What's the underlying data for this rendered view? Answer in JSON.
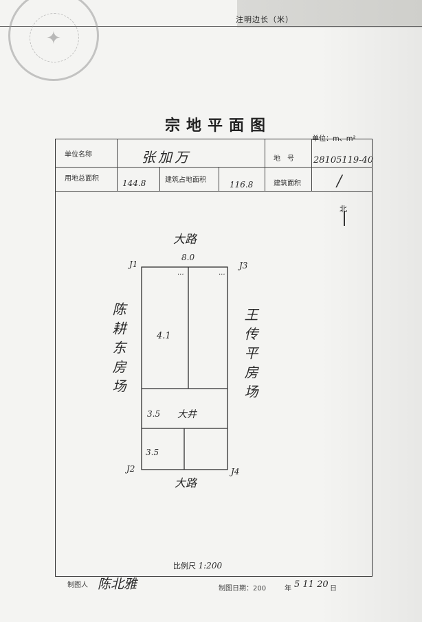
{
  "header": {
    "note": "注明边长（米）"
  },
  "seal": {
    "text": "印章",
    "color": "#9a9a9a"
  },
  "title": "宗地平面图",
  "unit": "单位：m、m²",
  "form": {
    "owner_label": "单位名称",
    "owner_value": "张加万",
    "parcel_label": "地　号",
    "parcel_value": "28105119-40",
    "land_area_label": "用地总面积",
    "land_area_value": "144.8",
    "building_area_label": "建筑占地面积",
    "building_area_value": "116.8",
    "floor_area_label": "建筑面积",
    "floor_area_value": "/"
  },
  "plan": {
    "north_label": "北",
    "north_side": "大路",
    "south_side": "大路",
    "top_dim": "8.0",
    "west_neighbor": "陈耕东房场",
    "east_neighbor": "王传平房场",
    "corner_labels": [
      "J1",
      "J2",
      "J3",
      "J4"
    ],
    "main_room": "4.1",
    "middle_room_dim": "3.5",
    "middle_room_text": "大井",
    "lower_room_dim": "3.5",
    "dots": "..."
  },
  "footer": {
    "scale_label": "比例尺",
    "scale_value": "1:200",
    "drafter_label": "制图人",
    "drafter_value": "陈北雅",
    "date_label": "制图日期：200",
    "date_mid": "年",
    "date_value": "5 11 20",
    "date_end": "日"
  }
}
